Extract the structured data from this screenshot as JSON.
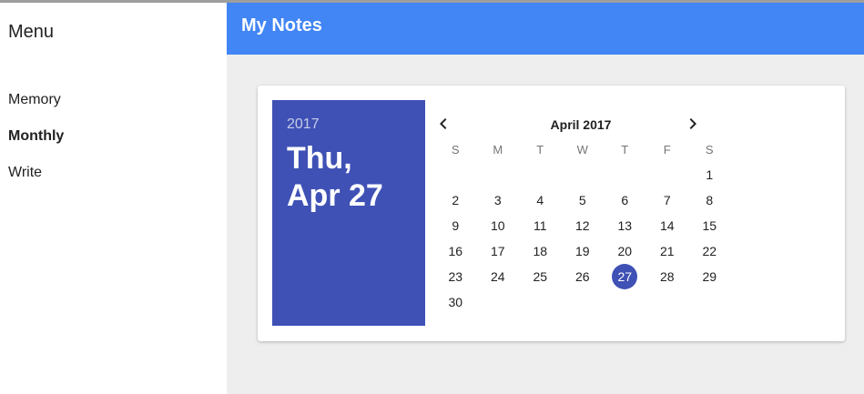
{
  "sidebar": {
    "title": "Menu",
    "items": [
      {
        "label": "Memory",
        "active": false
      },
      {
        "label": "Monthly",
        "active": true
      },
      {
        "label": "Write",
        "active": false
      }
    ]
  },
  "appbar": {
    "title": "My Notes",
    "color": "#4285f4"
  },
  "datepicker": {
    "year": "2017",
    "date_line1": "Thu,",
    "date_line2": "Apr 27",
    "month_label": "April 2017",
    "prev_icon": "chevron-left-icon",
    "next_icon": "chevron-right-icon",
    "weekdays": [
      "S",
      "M",
      "T",
      "W",
      "T",
      "F",
      "S"
    ],
    "first_weekday_index": 6,
    "days_in_month": 30,
    "selected_day": 27,
    "accent_color": "#3f51b5"
  }
}
